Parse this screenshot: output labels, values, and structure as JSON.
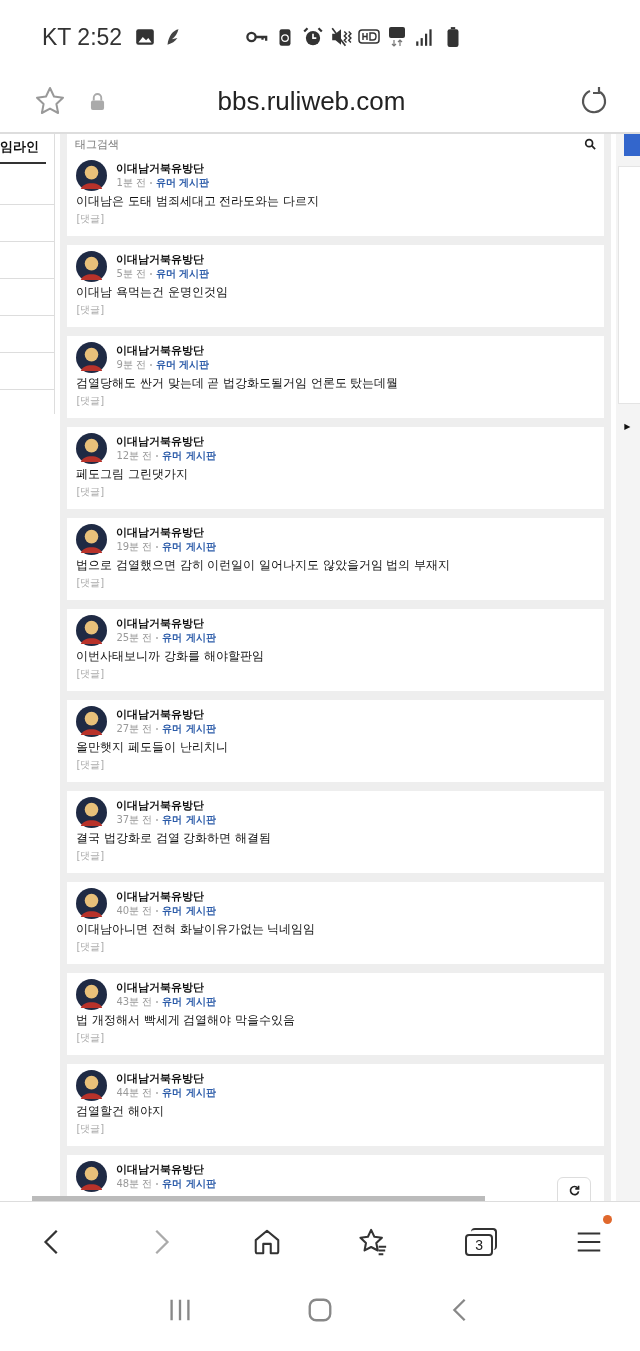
{
  "status_bar": {
    "carrier_time": "KT 2:52"
  },
  "address_bar": {
    "url": "bbs.ruliweb.com"
  },
  "sidebar": {
    "heading": "임라인"
  },
  "search": {
    "placeholder": "태그검색"
  },
  "comments": [
    {
      "author": "이대남거북유방단",
      "time": "1분 전",
      "board": "유머 게시판",
      "body": "이대남은 도태 범죄세대고 전라도와는 다르지",
      "reply_label": "[댓글]"
    },
    {
      "author": "이대남거북유방단",
      "time": "5분 전",
      "board": "유머 게시판",
      "body": "이대남 욕먹는건 운명인것임",
      "reply_label": "[댓글]"
    },
    {
      "author": "이대남거북유방단",
      "time": "9분 전",
      "board": "유머 게시판",
      "body": "검열당해도 싼거 맞는데 곧 법강화도될거임 언론도 탔는데뭘",
      "reply_label": "[댓글]"
    },
    {
      "author": "이대남거북유방단",
      "time": "12분 전",
      "board": "유머 게시판",
      "body": "페도그림 그린댓가지",
      "reply_label": "[댓글]"
    },
    {
      "author": "이대남거북유방단",
      "time": "19분 전",
      "board": "유머 게시판",
      "body": "법으로 검열했으면 감히 이런일이 일어나지도 않았을거임 법의 부재지",
      "reply_label": "[댓글]"
    },
    {
      "author": "이대남거북유방단",
      "time": "25분 전",
      "board": "유머 게시판",
      "body": "이번사태보니까 강화를 해야할판임",
      "reply_label": "[댓글]"
    },
    {
      "author": "이대남거북유방단",
      "time": "27분 전",
      "board": "유머 게시판",
      "body": "올만햇지 페도들이 난리치니",
      "reply_label": "[댓글]"
    },
    {
      "author": "이대남거북유방단",
      "time": "37분 전",
      "board": "유머 게시판",
      "body": "결국 법강화로 검열 강화하면 해결됨",
      "reply_label": "[댓글]"
    },
    {
      "author": "이대남거북유방단",
      "time": "40분 전",
      "board": "유머 게시판",
      "body": "이대남아니면 전혀 화날이유가없는 닉네임임",
      "reply_label": "[댓글]"
    },
    {
      "author": "이대남거북유방단",
      "time": "43분 전",
      "board": "유머 게시판",
      "body": "법 개정해서 빡세게 검열해야 막을수있음",
      "reply_label": "[댓글]"
    },
    {
      "author": "이대남거북유방단",
      "time": "44분 전",
      "board": "유머 게시판",
      "body": "검열할건 해야지",
      "reply_label": "[댓글]"
    },
    {
      "author": "이대남거북유방단",
      "time": "48분 전",
      "board": "유머 게시판"
    }
  ],
  "right_panel": {
    "arrow": "▶"
  },
  "toolbar": {
    "forward_disabled": true,
    "tab_count": "3",
    "menu_notification": true
  }
}
